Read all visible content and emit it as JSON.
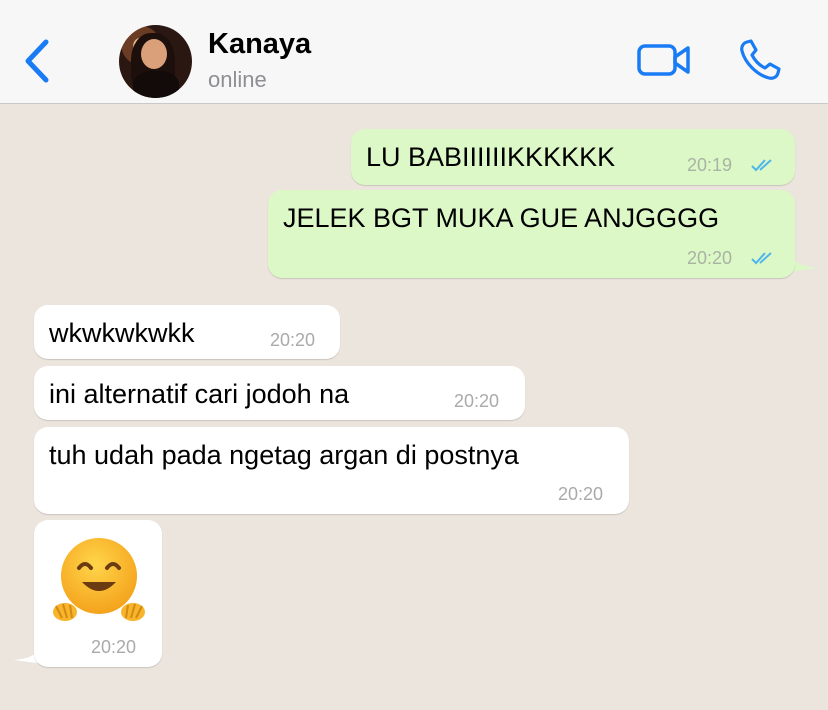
{
  "header": {
    "contact_name": "Kanaya",
    "contact_status": "online",
    "back_icon": "chevron-left-icon",
    "video_icon": "video-camera-icon",
    "call_icon": "phone-icon",
    "accent_color": "#1a7cf5"
  },
  "messages": [
    {
      "direction": "outgoing",
      "text": "LU BABIIIIIIKKKKKK",
      "time": "20:19",
      "status": "read"
    },
    {
      "direction": "outgoing",
      "text": "JELEK BGT MUKA GUE ANJGGGG",
      "time": "20:20",
      "status": "read"
    },
    {
      "direction": "incoming",
      "text": "wkwkwkwkk",
      "time": "20:20"
    },
    {
      "direction": "incoming",
      "text": "ini alternatif cari jodoh na",
      "time": "20:20"
    },
    {
      "direction": "incoming",
      "text": "tuh udah pada ngetag argan di postnya",
      "time": "20:20"
    },
    {
      "direction": "incoming",
      "emoji": "hugging-face-emoji",
      "time": "20:20"
    }
  ],
  "colors": {
    "background": "#ece5dd",
    "outgoing_bubble": "#dcf8c6",
    "incoming_bubble": "#ffffff",
    "read_ticks": "#4fb6ec"
  }
}
